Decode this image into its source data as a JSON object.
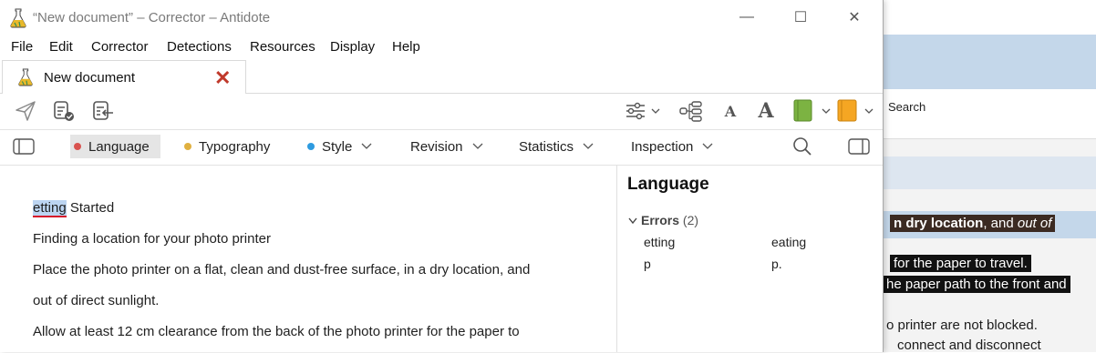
{
  "window": {
    "title": "“New document” – Corrector – Antidote",
    "controls": {
      "minimize": "—",
      "maximize": "☐",
      "close": "✕"
    }
  },
  "menu": [
    "File",
    "Edit",
    "Corrector",
    "Detections",
    "Resources",
    "Display",
    "Help"
  ],
  "document_tab": {
    "label": "New document",
    "close": "✕"
  },
  "toolbar": {
    "icons": [
      "send-icon",
      "correct-document-icon",
      "import-icon",
      "settings-sliders-icon",
      "hierarchy-icon",
      "font-small-icon",
      "font-large-icon",
      "green-book-icon",
      "orange-book-icon"
    ],
    "font_small": "A",
    "font_large": "A",
    "colors": {
      "green_book": "#7cb342",
      "orange_book": "#f5a623"
    }
  },
  "filter_tabs": [
    {
      "label": "Language",
      "dot": "#d9534f",
      "active": true
    },
    {
      "label": "Typography",
      "dot": "#e0b040"
    },
    {
      "label": "Style",
      "dot": "#2e9be0",
      "chevron": true
    },
    {
      "label": "Revision",
      "chevron": true
    },
    {
      "label": "Statistics",
      "chevron": true
    },
    {
      "label": "Inspection",
      "chevron": true
    }
  ],
  "document": {
    "highlight_word": "etting",
    "line1_rest": " Started",
    "lines": [
      "Finding a location for your photo printer",
      "Place the photo printer on a flat, clean and dust-free surface, in a dry location, and",
      "out of direct sunlight.",
      "Allow at least 12 cm clearance from the back of the photo printer for the paper to"
    ]
  },
  "panel": {
    "title": "Language",
    "group_label": "Errors",
    "group_count": "(2)",
    "errors": [
      {
        "found": "etting",
        "suggestion": "eating"
      },
      {
        "found": "p",
        "suggestion": "p."
      }
    ]
  },
  "background_app": {
    "search": "Search",
    "dark_line": "n dry location, and out of",
    "dark_bold": "n dry location",
    "dark_rest": ", and ",
    "dark_italic": "out of",
    "line2": "for the paper to travel.",
    "line3": "he paper path to the front and",
    "line4": "o printer are not blocked.",
    "line5": "connect and disconnect"
  }
}
